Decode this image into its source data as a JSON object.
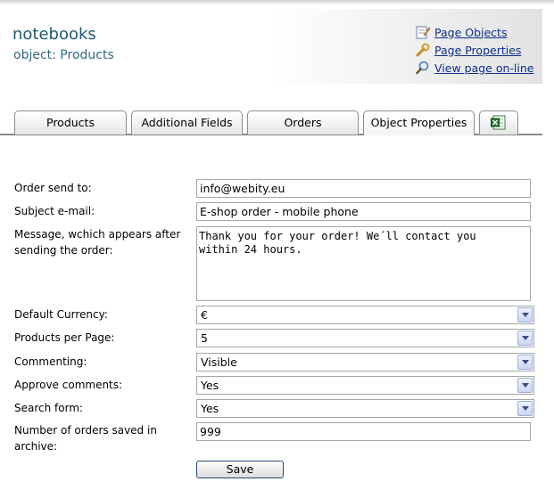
{
  "header": {
    "site_title": "notebooks",
    "object_line": "object: Products"
  },
  "links": [
    {
      "label": "Page Objects",
      "icon": "pencil-icon"
    },
    {
      "label": "Page Properties",
      "icon": "wrench-icon"
    },
    {
      "label": "View page on-line",
      "icon": "magnifier-icon"
    }
  ],
  "tabs": [
    {
      "label": "Products",
      "active": false
    },
    {
      "label": "Additional Fields",
      "active": false
    },
    {
      "label": "Orders",
      "active": false
    },
    {
      "label": "Object Properties",
      "active": true
    },
    {
      "label": "",
      "icon": "excel-icon",
      "active": false
    }
  ],
  "form": {
    "order_send_to": {
      "label": "Order send to:",
      "value": "info@webity.eu"
    },
    "subject_email": {
      "label": "Subject e-mail:",
      "value": "E-shop order - mobile phone"
    },
    "message": {
      "label_line1": "Message, wchich appears after",
      "label_line2": "sending the order:",
      "value": "Thank you for your order! We´ll contact you\nwithin 24 hours."
    },
    "default_currency": {
      "label": "Default Currency:",
      "value": "€"
    },
    "products_per_page": {
      "label": "Products per Page:",
      "value": "5"
    },
    "commenting": {
      "label": "Commenting:",
      "value": "Visible"
    },
    "approve_comments": {
      "label": "Approve comments:",
      "value": "Yes"
    },
    "search_form": {
      "label": "Search form:",
      "value": "Yes"
    },
    "orders_archive": {
      "label_line1": "Number of orders saved in",
      "label_line2": "archive:",
      "value": "999"
    }
  },
  "buttons": {
    "save_label": "Save"
  }
}
